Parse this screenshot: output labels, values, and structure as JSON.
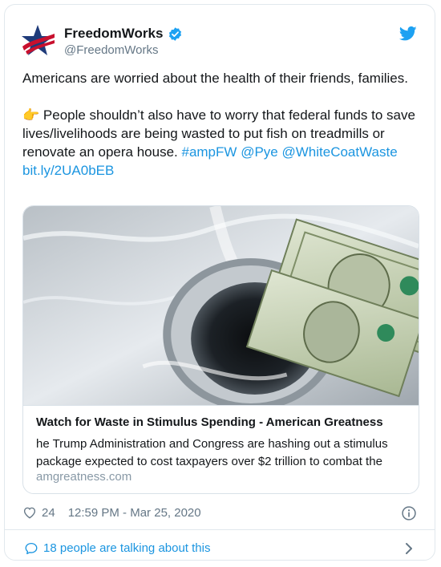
{
  "account": {
    "display_name": "FreedomWorks",
    "handle": "@FreedomWorks",
    "verified": true
  },
  "tweet": {
    "line1": "Americans are worried about the health of their friends, families.",
    "emoji": "👉",
    "body": " People shouldn’t also have to worry that federal funds to save lives/livelihoods are being wasted to put fish on treadmills or renovate an opera house. ",
    "links": [
      "#ampFW",
      "@Pye",
      "@WhiteCoatWaste",
      "bit.ly/2UA0bEB"
    ]
  },
  "link_card": {
    "title": "Watch for Waste in Stimulus Spending - American Greatness",
    "description": "he Trump Administration and Congress are hashing out a stimulus package expected to cost taxpayers over $2 trillion to combat the",
    "domain": "amgreatness.com",
    "image_alt": "sink drain with dollar bills"
  },
  "meta": {
    "likes": "24",
    "timestamp": "12:59 PM - Mar 25, 2020"
  },
  "footer": {
    "text": "18 people are talking about this"
  },
  "colors": {
    "link": "#1b95e0",
    "muted": "#657786",
    "brand_red": "#c8102e",
    "brand_navy": "#1f3b7a"
  },
  "icons": [
    "freedomworks-star-logo",
    "verified-badge-icon",
    "twitter-bird-icon",
    "heart-icon",
    "info-icon",
    "chat-bubble-icon",
    "chevron-right-icon"
  ]
}
